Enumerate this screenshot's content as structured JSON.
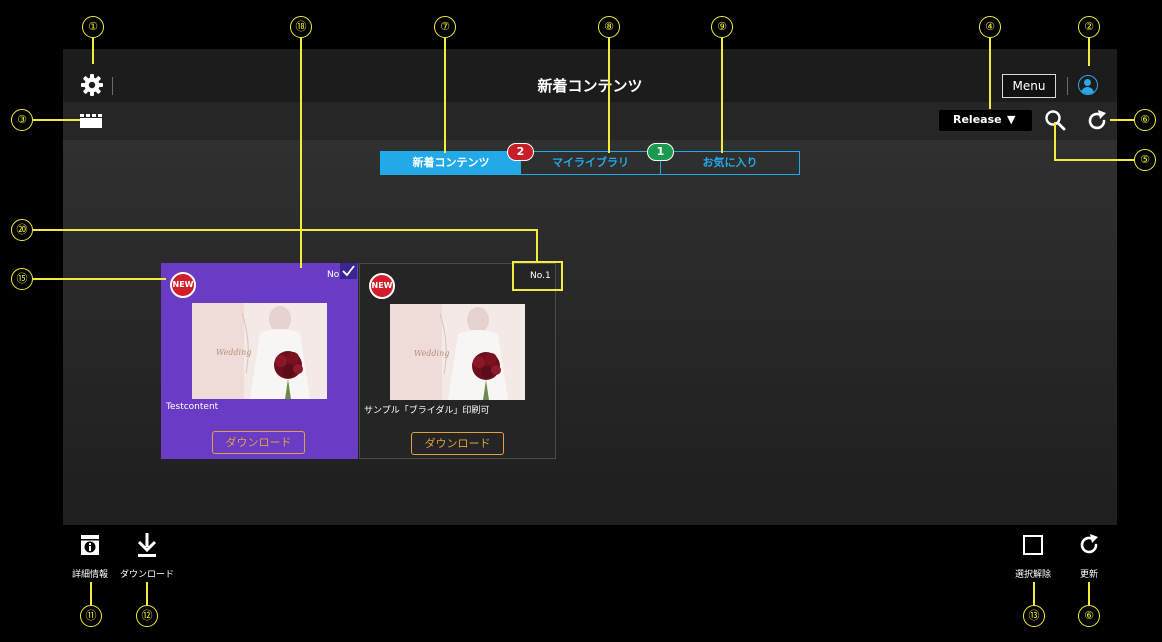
{
  "header": {
    "title": "新着コンテンツ",
    "menu_label": "Menu"
  },
  "toolbar": {
    "release_label": "Release",
    "release_arrow": "▼"
  },
  "tabs": [
    {
      "label": "新着コンテンツ",
      "active": true
    },
    {
      "label": "マイライブラリ",
      "badge": "2",
      "badge_color": "#c81e28"
    },
    {
      "label": "お気に入り",
      "badge": "1",
      "badge_color": "#1a9a4e"
    }
  ],
  "cards": [
    {
      "title": "Testcontent",
      "badge": "NEW",
      "number": "No",
      "download_label": "ダウンロード",
      "selected": true
    },
    {
      "title": "サンプル「ブライダル」印刷可",
      "badge": "NEW",
      "number": "No.1",
      "download_label": "ダウンロード",
      "selected": false
    }
  ],
  "bottombar": {
    "details_label": "詳細情報",
    "download_label": "ダウンロード",
    "deselect_label": "選択解除",
    "refresh_label": "更新"
  },
  "annotations": [
    "①",
    "②",
    "③",
    "④",
    "⑤",
    "⑥",
    "⑦",
    "⑧",
    "⑨",
    "⑪",
    "⑫",
    "⑬",
    "⑮",
    "⑱",
    "⑳"
  ],
  "colors": {
    "accent": "#22a9e8",
    "selected_card": "#6a3bc4",
    "download_border": "#e0a23e",
    "new_badge": "#d21e2a",
    "annotation": "#f2ec3a"
  },
  "icons": [
    "gear-icon",
    "user-icon",
    "clapper-icon",
    "search-icon",
    "refresh-icon",
    "checkmark-icon",
    "info-icon",
    "download-icon",
    "checkbox-icon"
  ]
}
